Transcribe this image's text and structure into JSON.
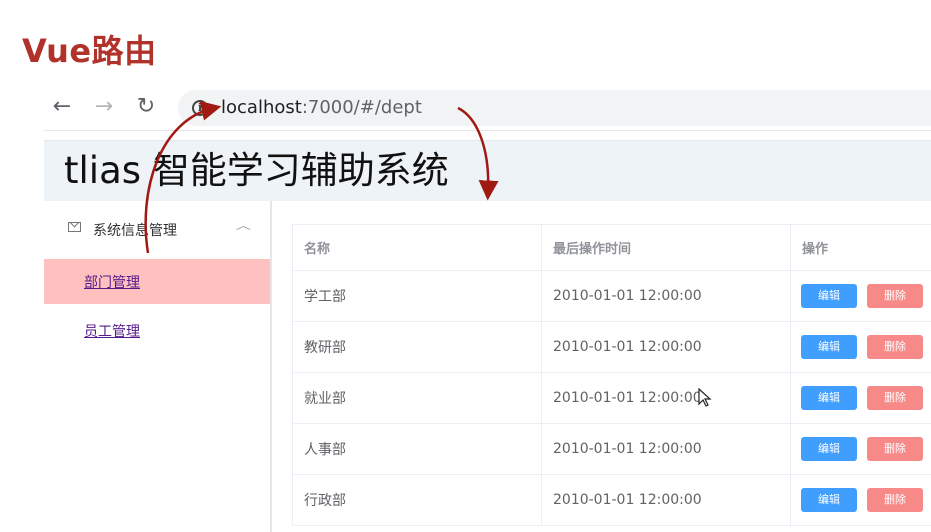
{
  "slide": {
    "title": "Vue路由"
  },
  "browser": {
    "url_host": "localhost",
    "url_path": ":7000/#/dept",
    "icons": {
      "back": "arrow-left-icon",
      "forward": "arrow-right-icon",
      "reload": "reload-icon",
      "info": "info-icon"
    }
  },
  "app": {
    "title": "tlias 智能学习辅助系统"
  },
  "sidebar": {
    "submenu_label": "系统信息管理",
    "items": [
      {
        "label": "部门管理",
        "active": true
      },
      {
        "label": "员工管理",
        "active": false
      }
    ]
  },
  "table": {
    "columns": [
      "名称",
      "最后操作时间",
      "操作"
    ],
    "rows": [
      {
        "name": "学工部",
        "time": "2010-01-01 12:00:00"
      },
      {
        "name": "教研部",
        "time": "2010-01-01 12:00:00"
      },
      {
        "name": "就业部",
        "time": "2010-01-01 12:00:00"
      },
      {
        "name": "人事部",
        "time": "2010-01-01 12:00:00"
      },
      {
        "name": "行政部",
        "time": "2010-01-01 12:00:00"
      }
    ],
    "edit_label": "编辑",
    "delete_label": "删除"
  },
  "colors": {
    "title": "#b0322a",
    "active_menu_bg": "#ffc0c0",
    "edit_button": "#409eff",
    "delete_button": "#f78989",
    "arrow": "#a01a12"
  }
}
